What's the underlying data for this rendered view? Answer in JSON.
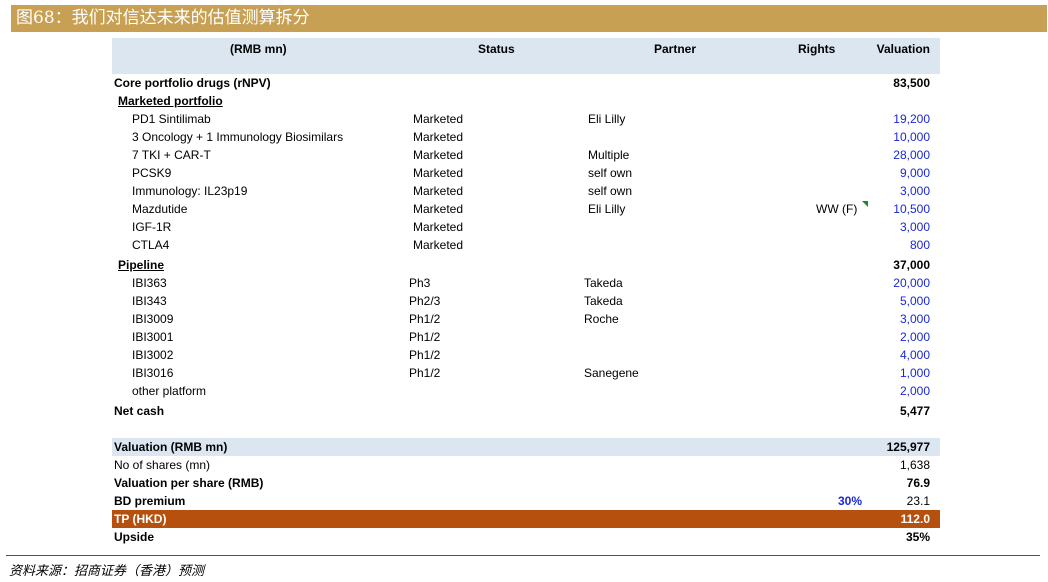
{
  "title": "图68：我们对信达未来的估值测算拆分",
  "header": {
    "col1": "(RMB mn)",
    "status": "Status",
    "partner": "Partner",
    "rights": "Rights",
    "valuation": "Valuation"
  },
  "core": {
    "label": "Core portfolio drugs (rNPV)",
    "value": "83,500"
  },
  "marketed_title": "Marketed portfolio",
  "marketed": [
    {
      "name": "PD1 Sintilimab",
      "status": "Marketed",
      "partner": "Eli Lilly",
      "rights": "",
      "value": "19,200"
    },
    {
      "name": "3 Oncology + 1 Immunology Biosimilars",
      "status": "Marketed",
      "partner": "",
      "rights": "",
      "value": "10,000"
    },
    {
      "name": "7 TKI + CAR-T",
      "status": "Marketed",
      "partner": "Multiple",
      "rights": "",
      "value": "28,000"
    },
    {
      "name": "PCSK9",
      "status": "Marketed",
      "partner": "self own",
      "rights": "",
      "value": "9,000"
    },
    {
      "name": "Immunology: IL23p19",
      "status": "Marketed",
      "partner": "self own",
      "rights": "",
      "value": "3,000"
    },
    {
      "name": "Mazdutide",
      "status": "Marketed",
      "partner": "Eli Lilly",
      "rights": "WW (F)",
      "value": "10,500"
    },
    {
      "name": "IGF-1R",
      "status": "Marketed",
      "partner": "",
      "rights": "",
      "value": "3,000"
    },
    {
      "name": "CTLA4",
      "status": "Marketed",
      "partner": "",
      "rights": "",
      "value": "800"
    }
  ],
  "pipeline_title": "Pipeline",
  "pipeline_total": "37,000",
  "pipeline": [
    {
      "name": "IBI363",
      "status": "Ph3",
      "partner": "Takeda",
      "value": "20,000"
    },
    {
      "name": "IBI343",
      "status": "Ph2/3",
      "partner": "Takeda",
      "value": "5,000"
    },
    {
      "name": "IBI3009",
      "status": "Ph1/2",
      "partner": "Roche",
      "value": "3,000"
    },
    {
      "name": "IBI3001",
      "status": "Ph1/2",
      "partner": "",
      "value": "2,000"
    },
    {
      "name": "IBI3002",
      "status": "Ph1/2",
      "partner": "",
      "value": "4,000"
    },
    {
      "name": "IBI3016",
      "status": "Ph1/2",
      "partner": "Sanegene",
      "value": "1,000"
    },
    {
      "name": "other platform",
      "status": "",
      "partner": "",
      "value": "2,000"
    }
  ],
  "net_cash": {
    "label": "Net cash",
    "value": "5,477"
  },
  "valuation": {
    "label": "Valuation (RMB mn)",
    "value": "125,977"
  },
  "shares": {
    "label": "No of shares (mn)",
    "value": "1,638"
  },
  "per_share": {
    "label": "Valuation per share (RMB)",
    "value": "76.9"
  },
  "bd": {
    "label": "BD premium",
    "pct": "30%",
    "value": "23.1"
  },
  "tp": {
    "label": "TP (HKD)",
    "value": "112.0"
  },
  "upside": {
    "label": "Upside",
    "value": "35%"
  },
  "source": "资料来源：招商证券（香港）预测",
  "colors": {
    "title_bg": "#c8a053",
    "header_bg": "#dce6f1",
    "tp_bg": "#b5500f",
    "blue_value": "#1a28d4"
  }
}
